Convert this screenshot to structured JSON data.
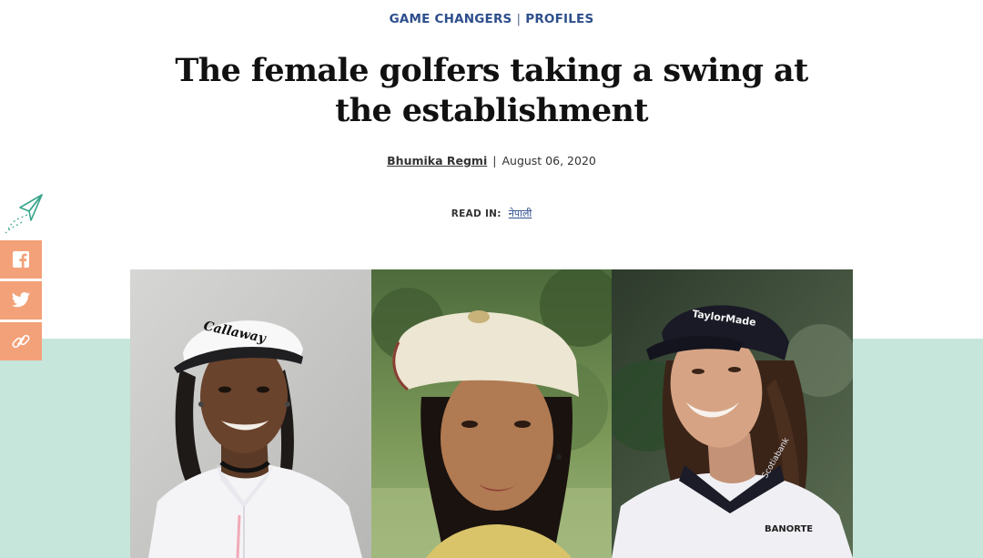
{
  "category": {
    "primary": "GAME CHANGERS",
    "separator": "|",
    "secondary": "PROFILES"
  },
  "article": {
    "title": "The female golfers taking a swing at the establishment",
    "author": "Bhumika Regmi",
    "byline_separator": "|",
    "date": "August 06, 2020"
  },
  "read_in": {
    "label": "READ IN:",
    "language": "नेपाली"
  },
  "share": {
    "icons": [
      "paper-plane-icon",
      "facebook-icon",
      "twitter-icon",
      "link-icon"
    ],
    "button_color": "#f3a179",
    "plane_color": "#3aa58c"
  },
  "hero": {
    "images": [
      "golfer-portrait-1",
      "golfer-portrait-2",
      "golfer-portrait-3"
    ],
    "cap_text_left": "Callaway",
    "cap_text_right": "TaylorMade",
    "shirt_text_right": "BANORTE",
    "collar_text_right": "Scotiabank"
  },
  "colors": {
    "mint_band": "#c6e6dc",
    "link_blue": "#2d4e8c"
  }
}
